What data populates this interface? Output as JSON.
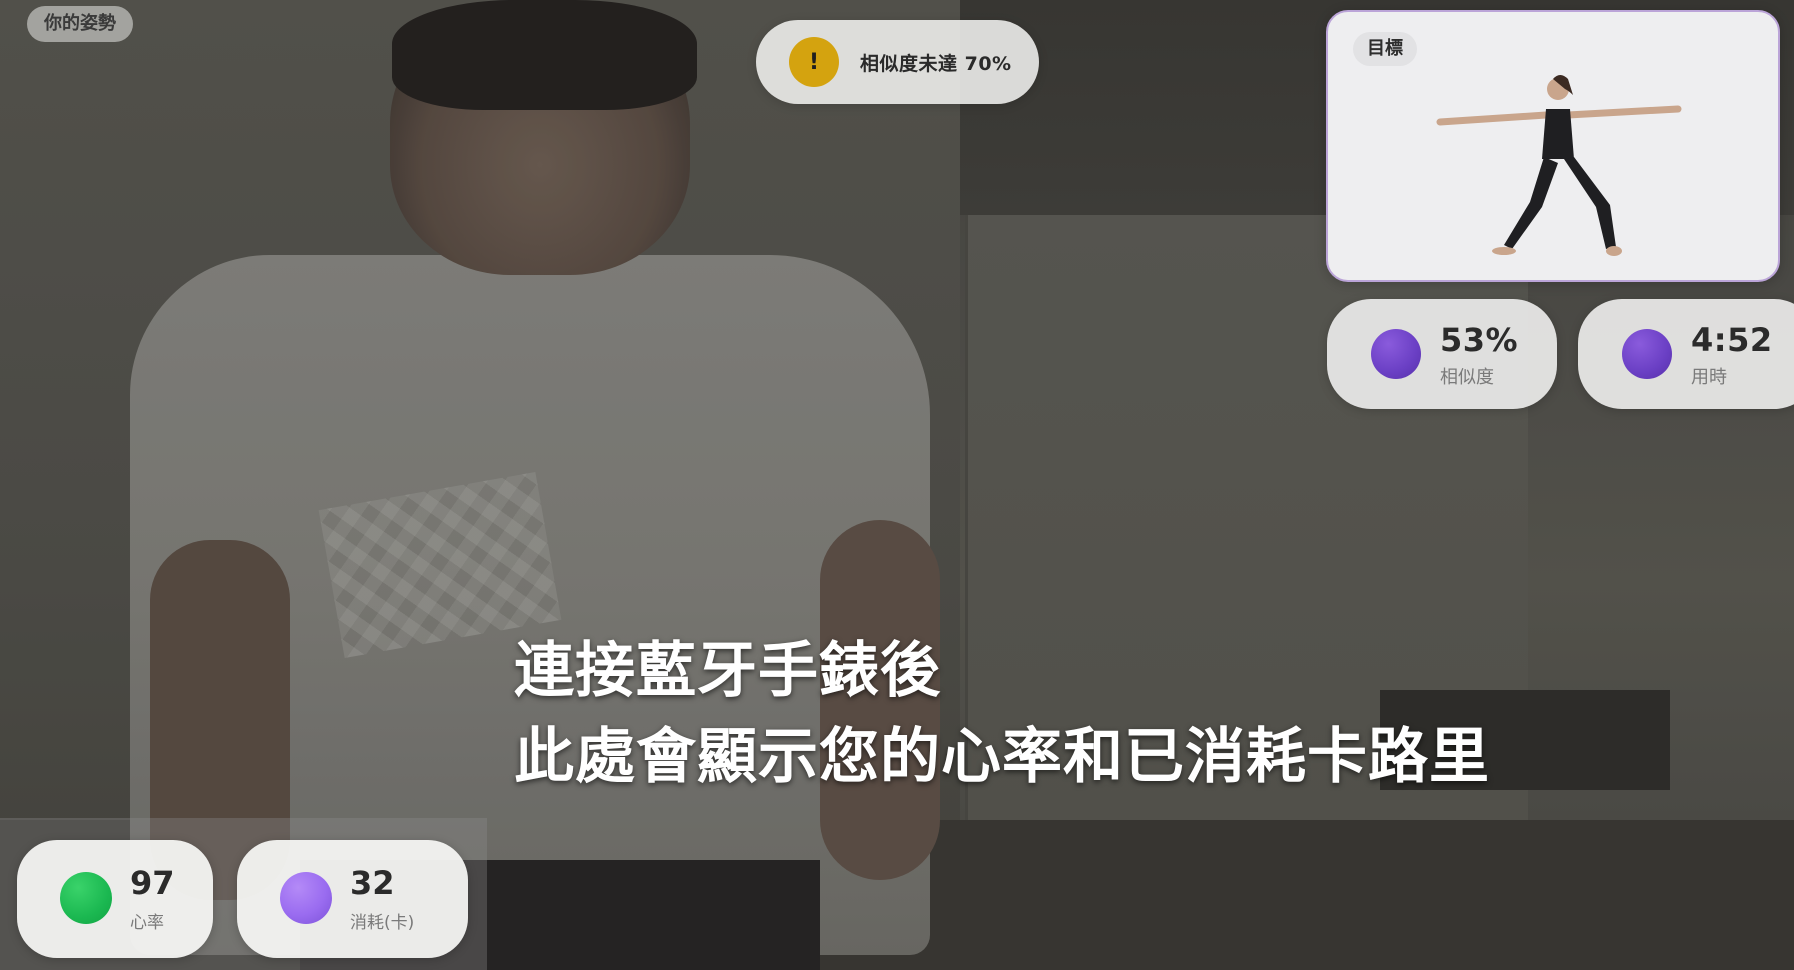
{
  "pose_label": "你的姿勢",
  "warning": {
    "icon": "!",
    "text": "相似度未達 70%",
    "color": "#d4a30f"
  },
  "target": {
    "label": "目標",
    "image": "warrior-pose-figure"
  },
  "stats": {
    "similarity": {
      "value": "53%",
      "label": "相似度"
    },
    "time": {
      "value": "4:52",
      "label": "用時"
    }
  },
  "subtitle": {
    "line1": "連接藍牙手錶後",
    "line2": "此處會顯示您的心率和已消耗卡路里"
  },
  "health": {
    "heart_rate": {
      "value": "97",
      "label": "心率",
      "color": "#1bb851"
    },
    "calories": {
      "value": "32",
      "label": "消耗(卡)",
      "color": "#9a6cf0"
    }
  },
  "colors": {
    "accent_purple": "#6a3fc4",
    "target_border": "#bba4d8"
  }
}
